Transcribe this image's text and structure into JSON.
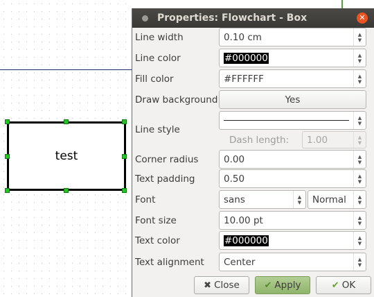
{
  "dialog": {
    "title": "Properties: Flowchart - Box"
  },
  "canvas": {
    "box_text": "test"
  },
  "properties": {
    "line_width": {
      "label": "Line width",
      "value": "0.10 cm"
    },
    "line_color": {
      "label": "Line color",
      "value": "#000000"
    },
    "fill_color": {
      "label": "Fill color",
      "value": "#FFFFFF"
    },
    "draw_background": {
      "label": "Draw background",
      "value": "Yes"
    },
    "line_style": {
      "label": "Line style",
      "dash_length_label": "Dash length:",
      "dash_length_value": "1.00"
    },
    "corner_radius": {
      "label": "Corner radius",
      "value": "0.00"
    },
    "text_padding": {
      "label": "Text padding",
      "value": "0.50"
    },
    "font": {
      "label": "Font",
      "family": "sans",
      "weight": "Normal"
    },
    "font_size": {
      "label": "Font size",
      "value": "10.00 pt"
    },
    "text_color": {
      "label": "Text color",
      "value": "#000000"
    },
    "text_alignment": {
      "label": "Text alignment",
      "value": "Center"
    }
  },
  "buttons": {
    "close": "Close",
    "apply": "Apply",
    "ok": "OK"
  },
  "icons": {
    "window_menu": "circle-icon",
    "window_close": "close-icon",
    "close_button": "x-icon",
    "apply_button": "checkmark-icon",
    "ok_button": "checkmark-icon"
  },
  "colors": {
    "titlebar": "#3e3d39",
    "close_accent": "#e95420",
    "apply_button": "#9fc27c",
    "handle": "#27c227"
  }
}
